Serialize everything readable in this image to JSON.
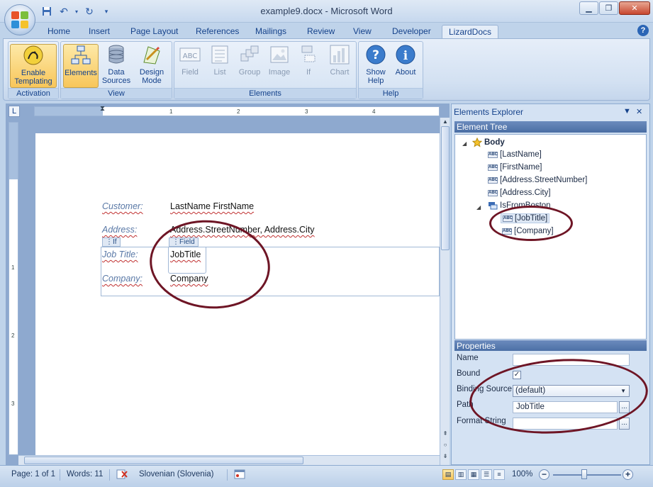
{
  "window": {
    "title": "example9.docx - Microsoft Word"
  },
  "tabs": [
    "Home",
    "Insert",
    "Page Layout",
    "References",
    "Mailings",
    "Review",
    "View",
    "Developer",
    "LizardDocs"
  ],
  "ribbon": {
    "groups": {
      "activation": "Activation",
      "view": "View",
      "elements": "Elements",
      "help": "Help"
    },
    "buttons": {
      "enable_templating": "Enable Templating",
      "elements": "Elements",
      "data_sources": "Data Sources",
      "design_mode": "Design Mode",
      "field": "Field",
      "list": "List",
      "group": "Group",
      "image": "Image",
      "if": "If",
      "chart": "Chart",
      "show_help": "Show Help",
      "about": "About"
    }
  },
  "document": {
    "customer_label": "Customer:",
    "customer_value": "LastName  FirstName",
    "address_label": "Address:",
    "address_value": "Address.StreetNumber,  Address.City",
    "if_tag": "If",
    "field_tag": "Field",
    "jobtitle_label": "Job Title:",
    "jobtitle_value": "JobTitle",
    "company_label": "Company:",
    "company_value": "Company",
    "ruler_marks": [
      "1",
      "2",
      "3",
      "4"
    ],
    "vruler_marks": [
      "1",
      "2",
      "3"
    ]
  },
  "explorer": {
    "title": "Elements Explorer",
    "tree_header": "Element Tree",
    "nodes": {
      "body": "Body",
      "lastname": "[LastName]",
      "firstname": "[FirstName]",
      "street": "[Address.StreetNumber]",
      "city": "[Address.City]",
      "isfromboston": "IsFromBoston",
      "jobtitle": "[JobTitle]",
      "company": "[Company]"
    },
    "abc_icon": "ABC",
    "properties_header": "Properties",
    "props": {
      "name_label": "Name",
      "name_value": "",
      "bound_label": "Bound",
      "bound_checked": "✓",
      "binding_source_label": "Binding Source",
      "binding_source_value": "(default)",
      "path_label": "Path",
      "path_value": "JobTitle",
      "format_string_label": "Format String",
      "format_string_value": "",
      "ellipsis": "..."
    }
  },
  "statusbar": {
    "page": "Page: 1 of 1",
    "words": "Words: 11",
    "language": "Slovenian (Slovenia)",
    "zoom": "100%"
  },
  "colors": {
    "accent": "#15428b",
    "annotation": "#6e1525",
    "active_button": "#f8c65a"
  }
}
